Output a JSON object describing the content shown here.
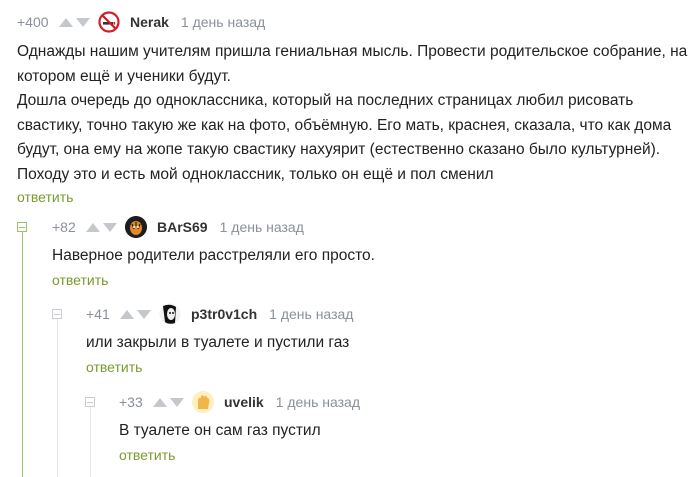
{
  "comments": [
    {
      "rating": "+400",
      "author": "Nerak",
      "time": "1 день назад",
      "lines": [
        "Однажды нашим учителям пришла гениальная мысль. Провести родительское собрание, на",
        "котором ещё и ученики будут.",
        "Дошла очередь до одноклассника, который на последних страницах любил рисовать",
        "свастику, точно такую же как на фото, объёмную. Его мать, краснея, сказала, что как дома",
        "будут, она ему на жопе такую свастику нахуярит (естественно сказано было культурней).",
        "Походу это и есть мой одноклассник, только он ещё и пол сменил"
      ],
      "reply": "ответить"
    },
    {
      "rating": "+82",
      "author": "BArS69",
      "time": "1 день назад",
      "lines": [
        "Наверное родители расстреляли его просто."
      ],
      "reply": "ответить"
    },
    {
      "rating": "+41",
      "author": "p3tr0v1ch",
      "time": "1 день назад",
      "lines": [
        "или закрыли в туалете и пустили газ"
      ],
      "reply": "ответить"
    },
    {
      "rating": "+33",
      "author": "uvelik",
      "time": "1 день назад",
      "lines": [
        "В туалете он сам газ пустил"
      ],
      "reply": "ответить"
    }
  ],
  "colors": {
    "reply": "#7a9a2e",
    "meta": "#8a9099",
    "thread_line_active": "#9ac46a",
    "thread_line": "#e3e6ea"
  },
  "icons": [
    "arrow-up-icon",
    "arrow-down-icon",
    "avatar-no-smoking",
    "avatar-tiger",
    "avatar-face",
    "avatar-hand"
  ]
}
